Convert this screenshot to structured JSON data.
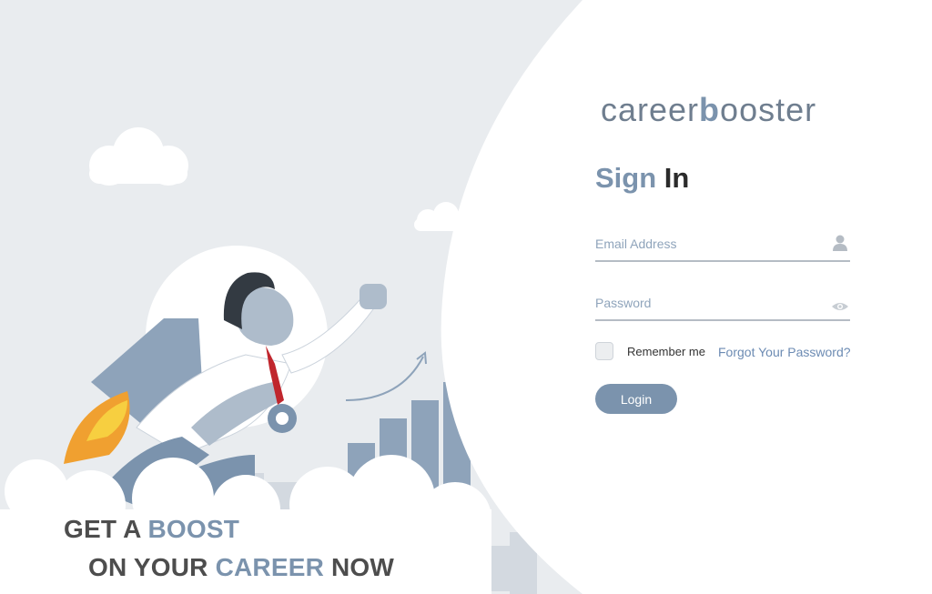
{
  "hero": {
    "tagline_line1_prefix": "GET A ",
    "tagline_line1_accent": "BOOST",
    "tagline_line2_prefix": "ON YOUR ",
    "tagline_line2_accent": "CAREER",
    "tagline_line2_suffix": " NOW"
  },
  "brand": {
    "logo_pre": "career",
    "logo_b": "b",
    "logo_post": "ooster"
  },
  "signin": {
    "title_accent": "Sign",
    "title_rest": " In",
    "email_placeholder": "Email Address",
    "email_value": "",
    "password_placeholder": "Password",
    "password_value": "",
    "remember_label": "Remember me",
    "remember_checked": false,
    "forgot_label": "Forgot Your Password?",
    "login_label": "Login"
  },
  "icons": {
    "email": "user-icon",
    "password": "eye-icon"
  },
  "colors": {
    "accent": "#7b93ad",
    "background": "#e9ecef",
    "panel": "#ffffff",
    "rocket_flame": "#f0a030",
    "tie": "#c0262d"
  }
}
